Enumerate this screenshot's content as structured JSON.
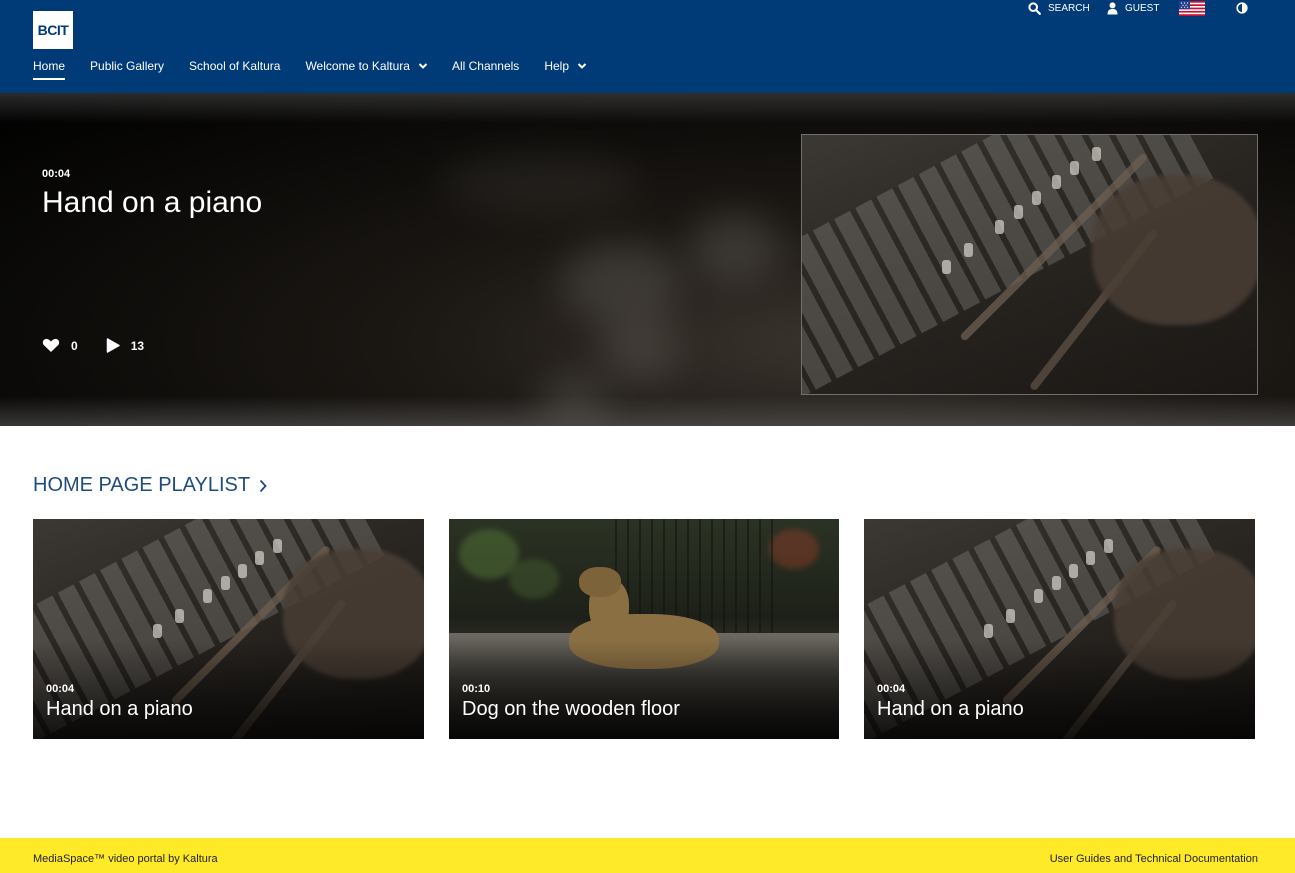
{
  "header": {
    "logo_text": "BCIT",
    "nav": [
      {
        "label": "Home",
        "active": true
      },
      {
        "label": "Public Gallery"
      },
      {
        "label": "School of Kaltura"
      },
      {
        "label": "Welcome to Kaltura",
        "dropdown": true
      },
      {
        "label": "All Channels"
      },
      {
        "label": "Help",
        "dropdown": true
      }
    ],
    "search_label": "SEARCH",
    "user_label": "GUEST",
    "language_icon": "us-flag-icon",
    "contrast_icon": "contrast-icon",
    "background_color": "#003a77"
  },
  "hero": {
    "duration": "00:04",
    "title": "Hand on a piano",
    "likes": "0",
    "plays": "13"
  },
  "playlist": {
    "title": "HOME PAGE PLAYLIST",
    "items": [
      {
        "duration": "00:04",
        "title": "Hand on a piano"
      },
      {
        "duration": "00:10",
        "title": "Dog on the wooden floor"
      },
      {
        "duration": "00:04",
        "title": "Hand on a piano"
      }
    ]
  },
  "footer": {
    "left_text": "MediaSpace™ video portal by Kaltura",
    "right_link": "User Guides and Technical Documentation",
    "background_color": "#ffea2a"
  }
}
